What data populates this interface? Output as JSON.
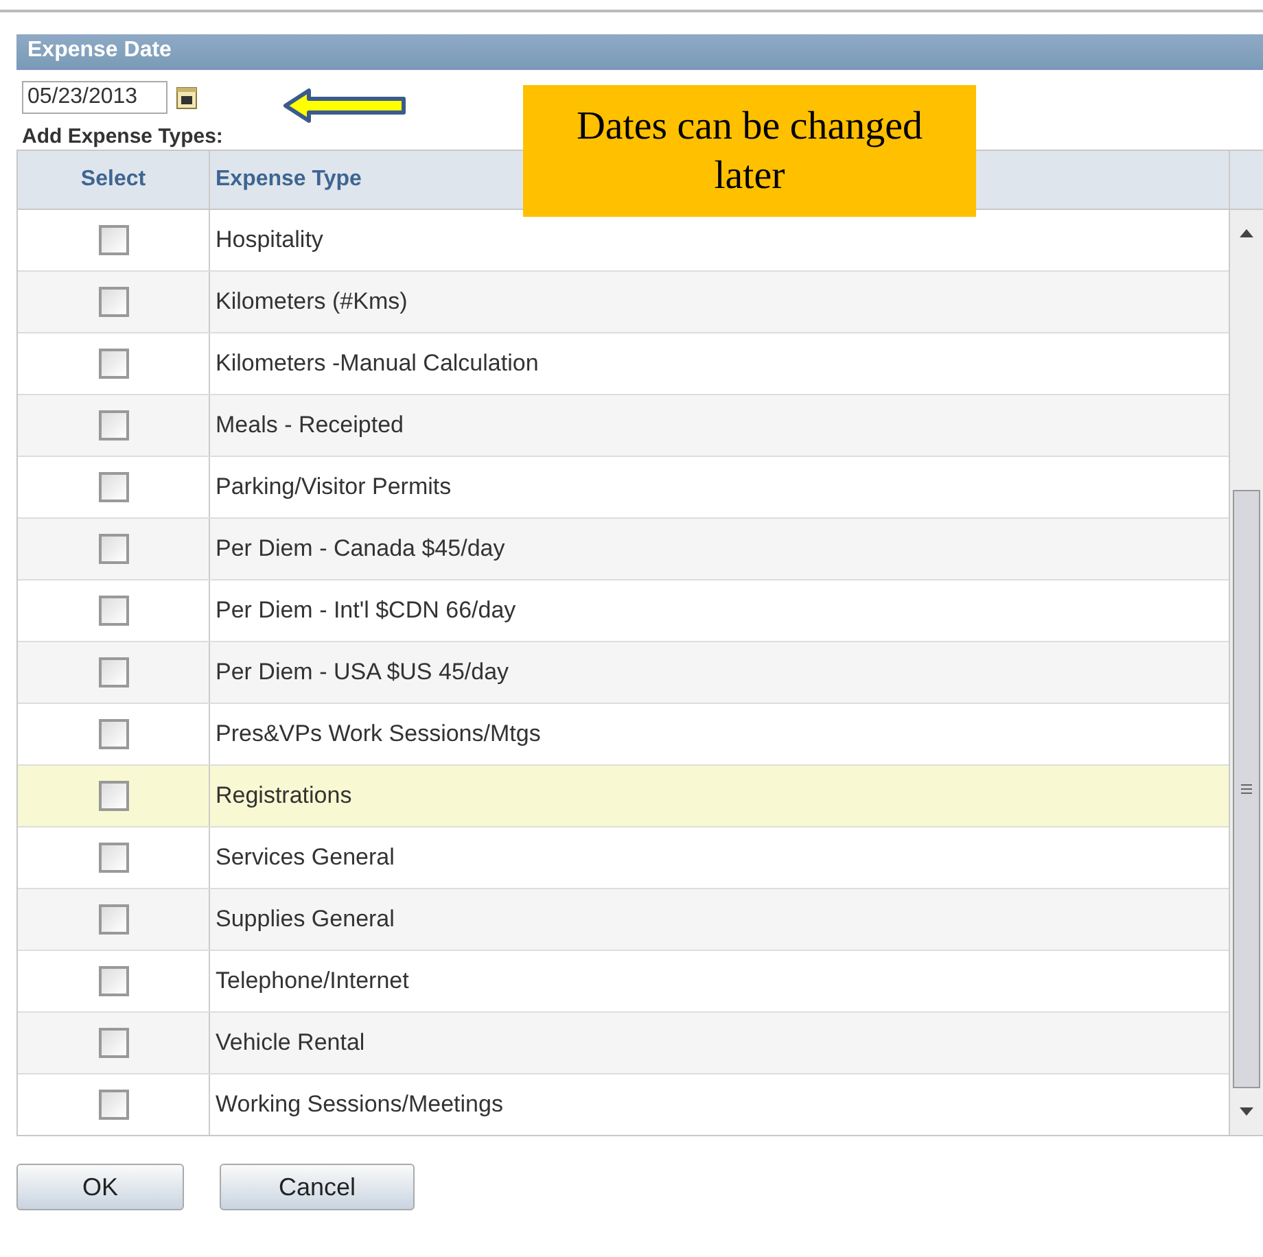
{
  "section": {
    "title": "Expense Date"
  },
  "date_field": {
    "value": "05/23/2013"
  },
  "callout": {
    "text": "Dates can be changed later"
  },
  "table": {
    "label": "Add Expense Types:",
    "columns": [
      "Select",
      "Expense Type"
    ],
    "rows": [
      {
        "name": "Hospitality",
        "checked": false,
        "selected": false
      },
      {
        "name": "Kilometers (#Kms)",
        "checked": false,
        "selected": false
      },
      {
        "name": "Kilometers -Manual Calculation",
        "checked": false,
        "selected": false
      },
      {
        "name": "Meals - Receipted",
        "checked": false,
        "selected": false
      },
      {
        "name": "Parking/Visitor Permits",
        "checked": false,
        "selected": false
      },
      {
        "name": "Per Diem - Canada $45/day",
        "checked": false,
        "selected": false
      },
      {
        "name": "Per Diem - Int'l  $CDN 66/day",
        "checked": false,
        "selected": false
      },
      {
        "name": "Per Diem - USA $US 45/day",
        "checked": false,
        "selected": false
      },
      {
        "name": "Pres&VPs Work Sessions/Mtgs",
        "checked": false,
        "selected": false
      },
      {
        "name": "Registrations",
        "checked": false,
        "selected": true
      },
      {
        "name": "Services General",
        "checked": false,
        "selected": false
      },
      {
        "name": "Supplies General",
        "checked": false,
        "selected": false
      },
      {
        "name": "Telephone/Internet",
        "checked": false,
        "selected": false
      },
      {
        "name": "Vehicle Rental",
        "checked": false,
        "selected": false
      },
      {
        "name": "Working Sessions/Meetings",
        "checked": false,
        "selected": false
      }
    ]
  },
  "buttons": [
    "OK",
    "Cancel"
  ]
}
